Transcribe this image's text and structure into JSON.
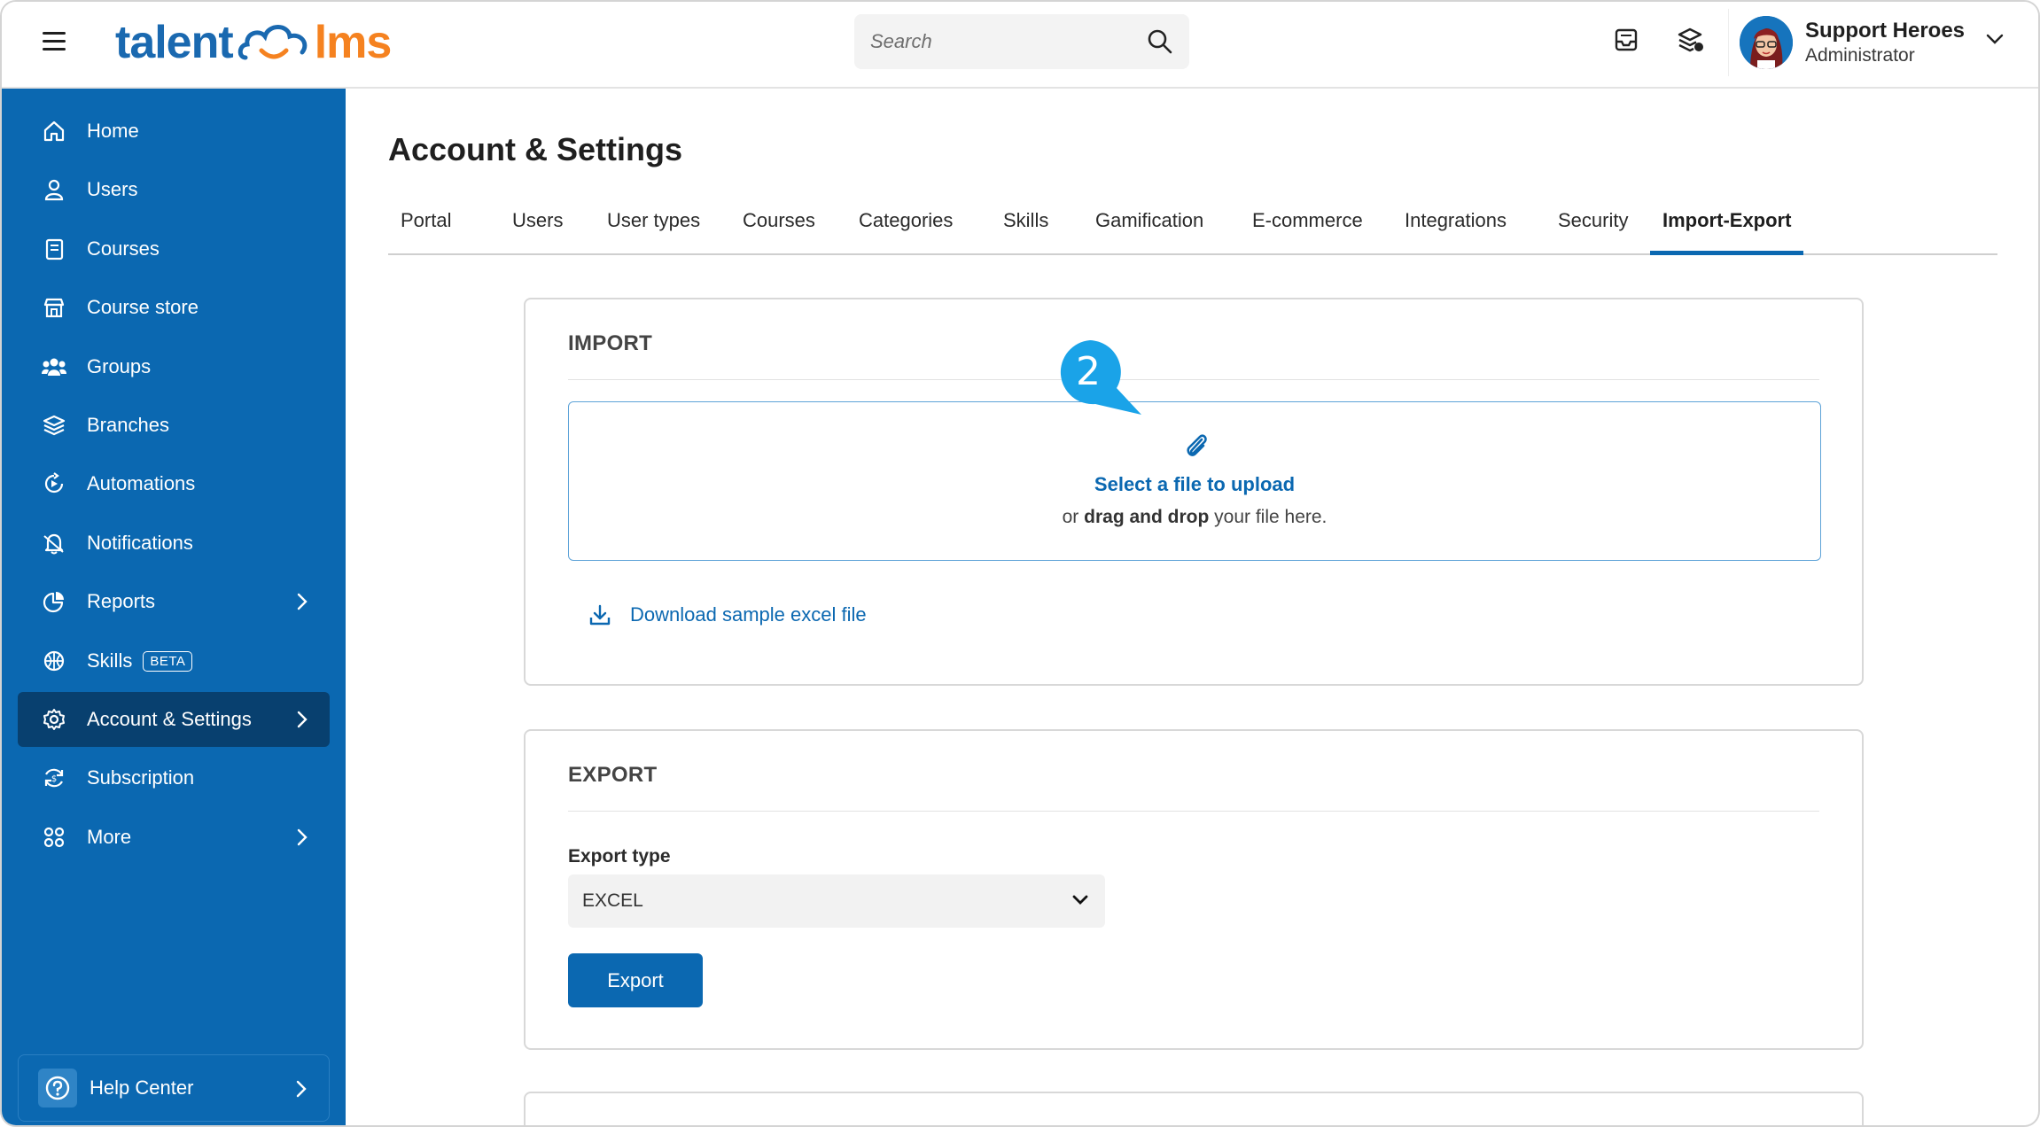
{
  "app": {
    "logo_left": "talent",
    "logo_right": "lms"
  },
  "search": {
    "placeholder": "Search"
  },
  "header_icons": [
    "inbox-icon",
    "layers-icon"
  ],
  "user": {
    "name": "Support Heroes",
    "role": "Administrator"
  },
  "sidebar": {
    "items": [
      {
        "label": "Home",
        "icon": "home-icon"
      },
      {
        "label": "Users",
        "icon": "user-icon"
      },
      {
        "label": "Courses",
        "icon": "book-icon"
      },
      {
        "label": "Course store",
        "icon": "store-icon"
      },
      {
        "label": "Groups",
        "icon": "groups-icon"
      },
      {
        "label": "Branches",
        "icon": "branches-icon"
      },
      {
        "label": "Automations",
        "icon": "automation-icon"
      },
      {
        "label": "Notifications",
        "icon": "bell-icon"
      },
      {
        "label": "Reports",
        "icon": "pie-chart-icon"
      },
      {
        "label": "Skills",
        "icon": "skills-icon",
        "badge": "BETA"
      },
      {
        "label": "Account & Settings",
        "icon": "gear-icon"
      },
      {
        "label": "Subscription",
        "icon": "subscription-icon"
      },
      {
        "label": "More",
        "icon": "grid-icon"
      }
    ],
    "help": "Help Center"
  },
  "page": {
    "title": "Account & Settings"
  },
  "tabs": [
    "Portal",
    "Users",
    "User types",
    "Courses",
    "Categories",
    "Skills",
    "Gamification",
    "E-commerce",
    "Integrations",
    "Security",
    "Import-Export"
  ],
  "import": {
    "title": "IMPORT",
    "upload_link": "Select a file to upload",
    "drop_prefix": "or",
    "drop_bold": "drag and drop",
    "drop_suffix": "your file here.",
    "download_label": "Download sample excel file"
  },
  "marker": {
    "number": "2"
  },
  "export": {
    "title": "EXPORT",
    "type_label": "Export type",
    "type_value": "EXCEL",
    "button": "Export"
  },
  "colors": {
    "brand_blue": "#0b68b1",
    "sidebar_active": "#08406f",
    "accent_orange": "#f58220",
    "marker": "#1aa3e8"
  }
}
